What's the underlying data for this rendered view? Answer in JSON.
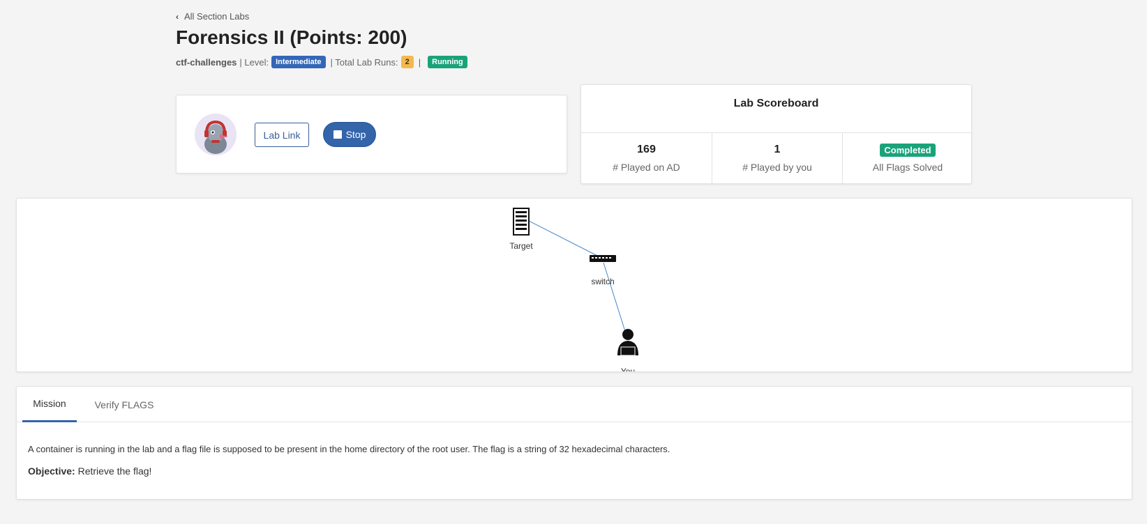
{
  "back_link": {
    "label": "All Section Labs"
  },
  "title": "Forensics II (Points: 200)",
  "meta": {
    "category": "ctf-challenges",
    "level_label": "| Level:",
    "level": "Intermediate",
    "runs_label": "| Total Lab Runs:",
    "runs": "2",
    "divider": "|",
    "status": "Running"
  },
  "controls": {
    "lab_link_label": "Lab Link",
    "stop_label": "Stop"
  },
  "scoreboard": {
    "title": "Lab Scoreboard",
    "played_ad_value": "169",
    "played_ad_label": "# Played on AD",
    "played_you_value": "1",
    "played_you_label": "# Played by you",
    "status_badge": "Completed",
    "status_label": "All Flags Solved"
  },
  "topology": {
    "nodes": [
      {
        "id": "target",
        "label": "Target",
        "icon": "server-icon"
      },
      {
        "id": "switch",
        "label": "switch",
        "icon": "switch-icon"
      },
      {
        "id": "you",
        "label": "You",
        "icon": "user-icon"
      }
    ],
    "links": [
      [
        "target",
        "switch"
      ],
      [
        "switch",
        "you"
      ]
    ]
  },
  "tabs": [
    {
      "label": "Mission",
      "active": true
    },
    {
      "label": "Verify FLAGS",
      "active": false
    }
  ],
  "mission": {
    "text": "A container is running in the lab and a flag file is supposed to be present in the home directory of the root user. The flag is a string of 32 hexadecimal characters.",
    "objective_label": "Objective:",
    "objective_text": "Retrieve the flag!"
  },
  "colors": {
    "primary": "#3465aa",
    "success": "#1aa37a",
    "warning": "#f5b94a",
    "link_line": "#4a86c8"
  }
}
